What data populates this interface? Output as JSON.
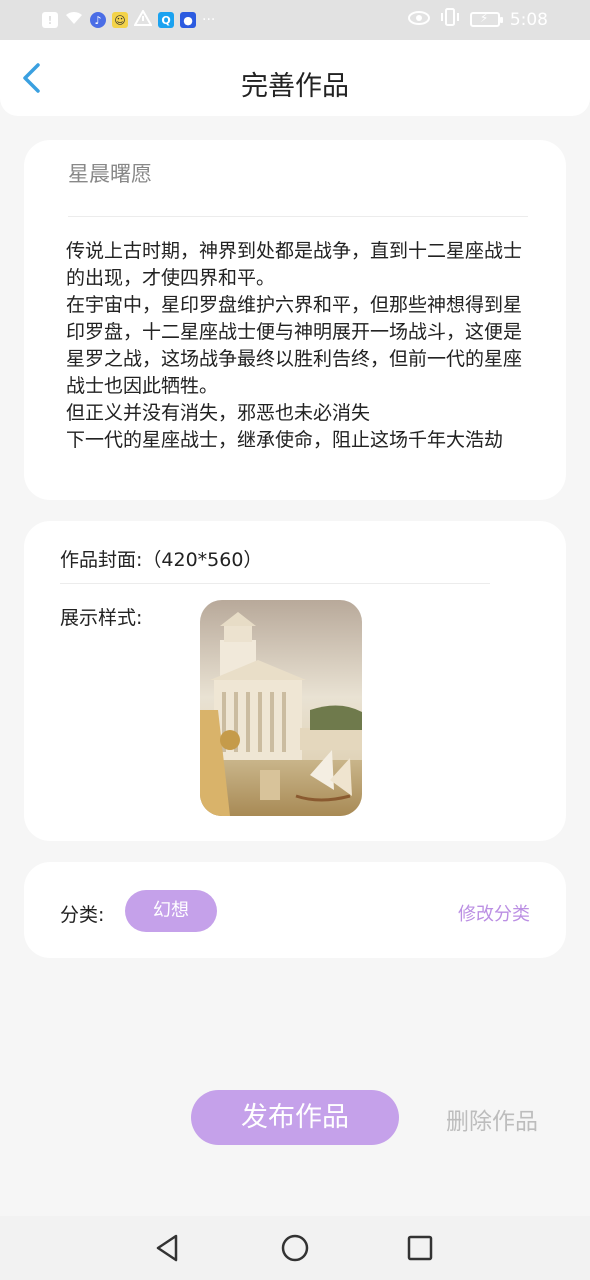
{
  "status_bar": {
    "time": "5:08",
    "icons": [
      "alert-icon",
      "wifi-icon",
      "music-app-icon",
      "emoji-app-icon",
      "warning-icon",
      "search-app-icon",
      "bulb-app-icon",
      "more-icon"
    ],
    "more_label": "···"
  },
  "header": {
    "title": "完善作品",
    "back_icon": "chevron-left-icon"
  },
  "work": {
    "title": "星晨曙愿",
    "body": "传说上古时期，神界到处都是战争，直到十二星座战士的出现，才使四界和平。\n在宇宙中，星印罗盘维护六界和平，但那些神想得到星印罗盘，十二星座战士便与神明展开一场战斗，这便是星罗之战，这场战争最终以胜利告终，但前一代的星座战士也因此牺牲。\n但正义并没有消失，邪恶也未必消失\n下一代的星座战士，继承使命，阻止这场千年大浩劫"
  },
  "cover": {
    "label": "作品封面:（420*560）",
    "style_label": "展示样式:",
    "image_icon": "classical-temple-painting"
  },
  "category": {
    "label": "分类:",
    "tag": "幻想",
    "edit_label": "修改分类"
  },
  "actions": {
    "publish": "发布作品",
    "delete": "删除作品"
  },
  "colors": {
    "accent": "#c5a1ea",
    "accent_text": "#bb8fe3",
    "back_arrow": "#3aa0e0",
    "background": "#f6f6f6"
  }
}
